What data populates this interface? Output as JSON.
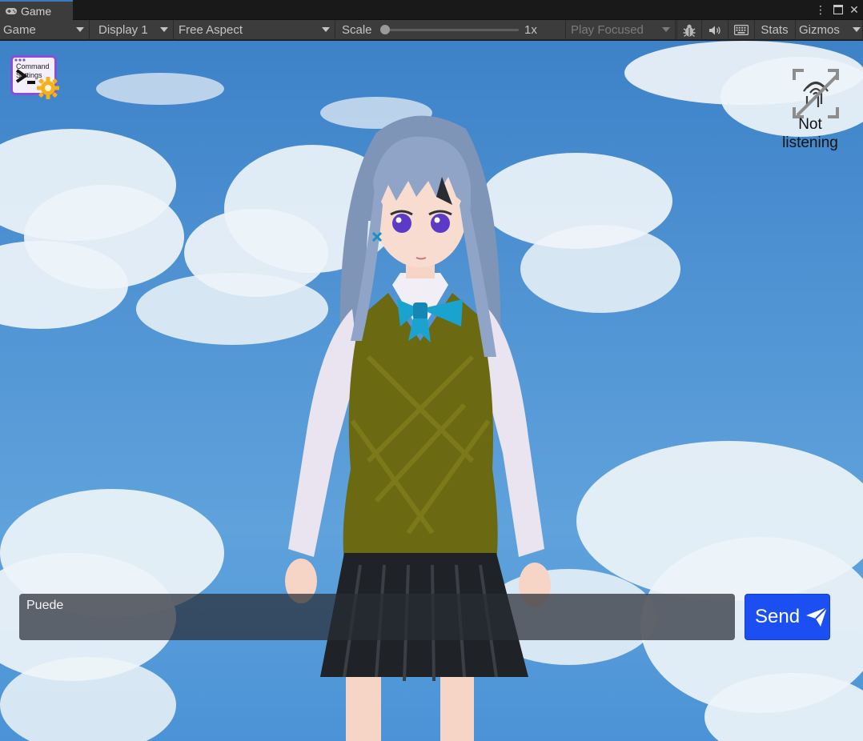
{
  "window": {
    "tab_title": "Game",
    "tab_icon": "gamepad-icon",
    "controls": [
      "more-options-icon",
      "maximize-icon",
      "close-icon"
    ]
  },
  "toolbar": {
    "view_mode": "Game",
    "display": "Display 1",
    "aspect": "Free Aspect",
    "scale_label": "Scale",
    "scale_value": "1x",
    "scale_level": 0,
    "play_mode": "Play Focused",
    "stats_label": "Stats",
    "gizmos_label": "Gizmos"
  },
  "overlay": {
    "command_settings_text": "Command Settings",
    "listening_status": "Not listening"
  },
  "chat": {
    "input_value": "Puede",
    "send_label": "Send"
  },
  "colors": {
    "sky": "#4f93d3",
    "send_button": "#1b4ff2",
    "tab_accent": "#3a79bb"
  }
}
